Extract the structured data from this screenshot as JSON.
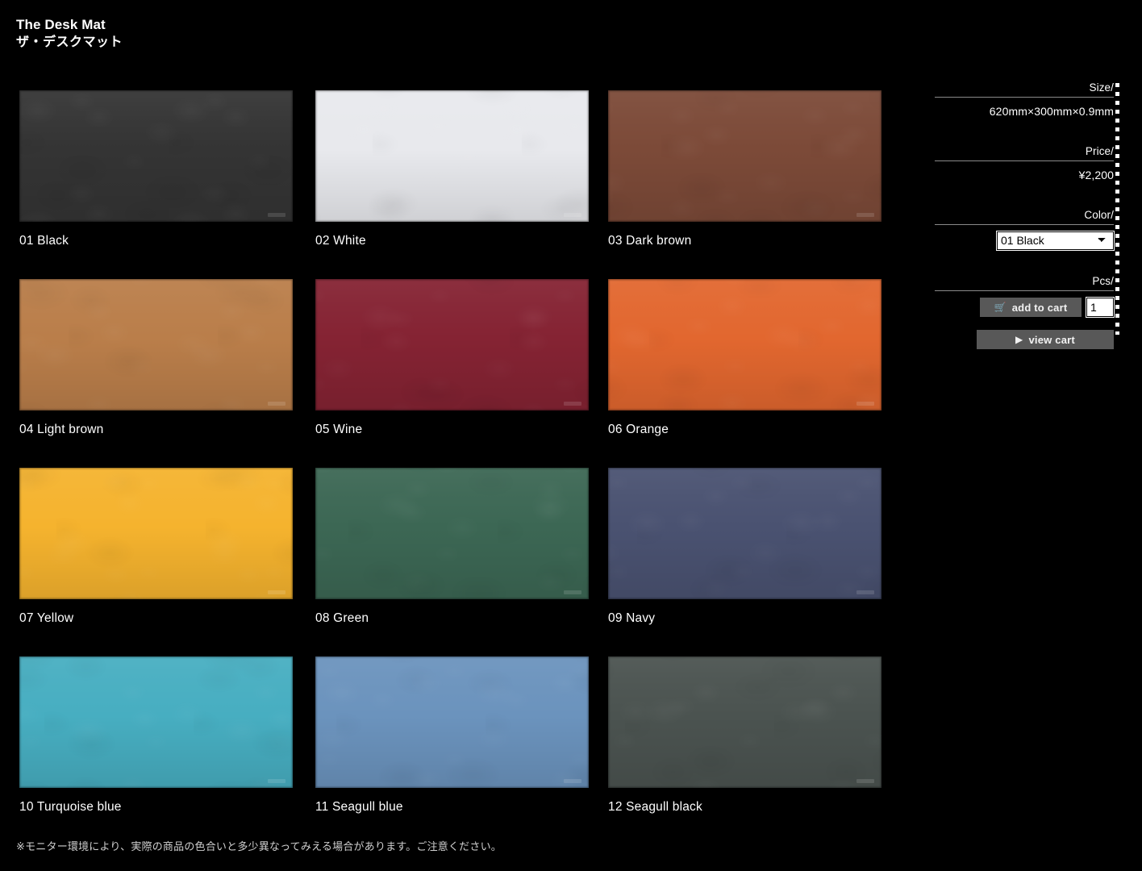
{
  "header": {
    "title_en": "The Desk Mat",
    "title_jp": "ザ・デスクマット"
  },
  "swatches": [
    {
      "label": "01 Black",
      "color": "#343434",
      "mark": "desk-mat-logo-mark"
    },
    {
      "label": "02 White",
      "color": "#e8e9ed",
      "mark": "desk-mat-logo-mark"
    },
    {
      "label": "03 Dark brown",
      "color": "#7c4a38",
      "mark": "desk-mat-logo-mark"
    },
    {
      "label": "04 Light brown",
      "color": "#ba7e4a",
      "mark": "desk-mat-logo-mark"
    },
    {
      "label": "05 Wine",
      "color": "#852333",
      "mark": "desk-mat-logo-mark"
    },
    {
      "label": "06 Orange",
      "color": "#e2672f",
      "mark": "desk-mat-logo-mark"
    },
    {
      "label": "07 Yellow",
      "color": "#f5b32e",
      "mark": "desk-mat-logo-mark"
    },
    {
      "label": "08 Green",
      "color": "#3c6754",
      "mark": "desk-mat-logo-mark"
    },
    {
      "label": "09 Navy",
      "color": "#4a5271",
      "mark": "desk-mat-logo-mark"
    },
    {
      "label": "10 Turquoise blue",
      "color": "#47aec1",
      "mark": "desk-mat-logo-mark"
    },
    {
      "label": "11 Seagull blue",
      "color": "#6b93bd",
      "mark": "desk-mat-logo-mark"
    },
    {
      "label": "12 Seagull black",
      "color": "#4b5350",
      "mark": "desk-mat-logo-mark"
    }
  ],
  "purchase": {
    "size_label": "Size/",
    "size_value": "620mm×300mm×0.9mm",
    "price_label": "Price/",
    "price_value": "¥2,200",
    "color_label": "Color/",
    "color_selected": "01 Black",
    "color_options": [
      "01 Black",
      "02 White",
      "03 Dark brown",
      "04 Light brown",
      "05 Wine",
      "06 Orange",
      "07 Yellow",
      "08 Green",
      "09 Navy",
      "10 Turquoise blue",
      "11 Seagull blue",
      "12 Seagull black"
    ],
    "pcs_label": "Pcs/",
    "qty_value": "1",
    "add_to_cart_label": "add to cart",
    "add_to_cart_icon": "shopping-cart-icon",
    "view_cart_label": "view cart",
    "view_cart_icon": "play-triangle-icon"
  },
  "footnote": "※モニター環境により、実際の商品の色合いと多少異なってみえる場合があります。ご注意ください。"
}
